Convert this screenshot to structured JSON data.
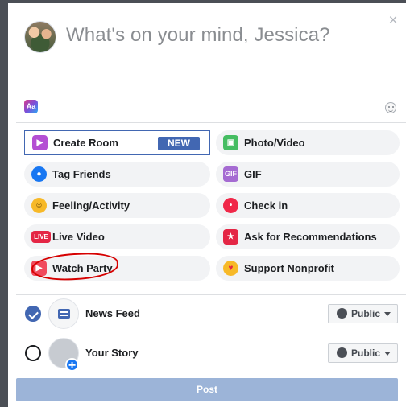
{
  "composer": {
    "prompt": "What's on your mind, Jessica?",
    "close_glyph": "×",
    "text_format_icon_text": "Aa"
  },
  "options": {
    "create_room": {
      "label": "Create Room",
      "badge": "NEW"
    },
    "photo_video": {
      "label": "Photo/Video"
    },
    "tag_friends": {
      "label": "Tag Friends"
    },
    "gif": {
      "label": "GIF",
      "icon_text": "GIF"
    },
    "feeling_activity": {
      "label": "Feeling/Activity"
    },
    "check_in": {
      "label": "Check in"
    },
    "live_video": {
      "label": "Live Video",
      "icon_text": "LIVE"
    },
    "ask_recommendations": {
      "label": "Ask for Recommendations"
    },
    "watch_party": {
      "label": "Watch Party"
    },
    "support_nonprofit": {
      "label": "Support Nonprofit"
    }
  },
  "share": {
    "news_feed": {
      "label": "News Feed",
      "privacy": "Public",
      "selected": true
    },
    "your_story": {
      "label": "Your Story",
      "privacy": "Public",
      "selected": false
    },
    "plus_glyph": "+"
  },
  "actions": {
    "post_label": "Post"
  },
  "colors": {
    "facebook_blue": "#4267b2",
    "option_background": "#f2f3f5",
    "disabled_post": "#9cb4d8",
    "annotation_red": "#d60000"
  },
  "icons": {
    "close": "close-icon",
    "text_format": "text-format-icon",
    "emoji": "emoji-icon",
    "room": "video-room-icon",
    "photo": "photo-video-icon",
    "tag": "tag-friends-icon",
    "gif": "gif-icon",
    "feeling": "feeling-icon",
    "location": "location-pin-icon",
    "live": "live-video-icon",
    "recommend": "recommendation-icon",
    "watch": "watch-party-icon",
    "heart": "nonprofit-heart-icon",
    "globe": "globe-icon",
    "caret": "caret-down-icon"
  }
}
